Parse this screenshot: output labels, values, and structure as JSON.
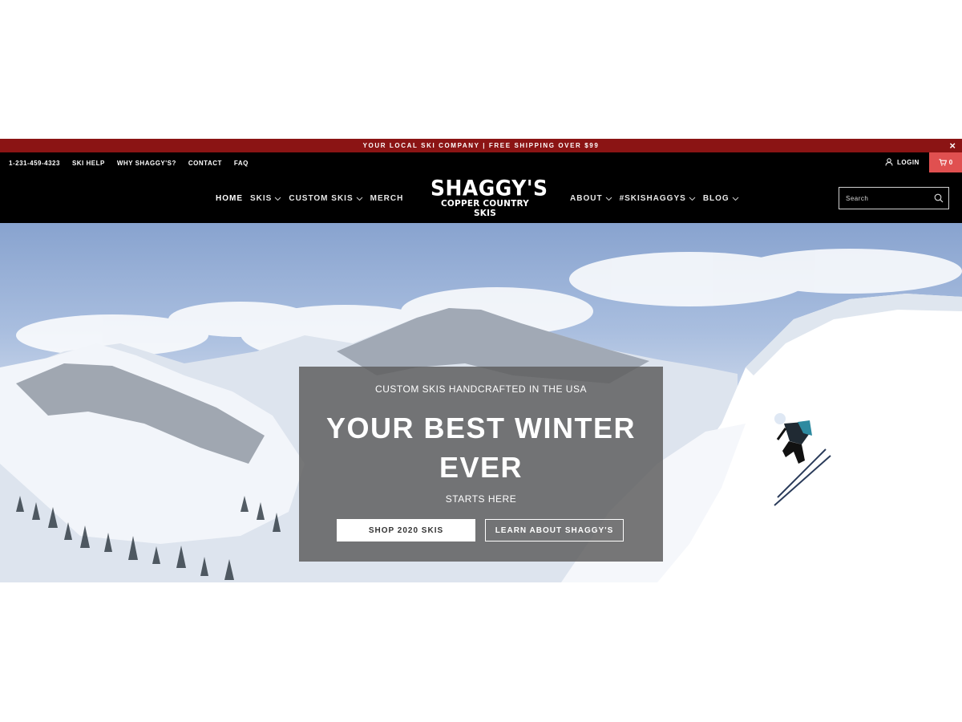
{
  "announcement": {
    "text": "YOUR LOCAL SKI COMPANY | FREE SHIPPING OVER $99",
    "close": "×"
  },
  "utility_nav": {
    "phone": "1-231-459-4323",
    "links": [
      "SKI HELP",
      "WHY SHAGGY'S?",
      "CONTACT",
      "FAQ"
    ]
  },
  "account": {
    "login": "LOGIN",
    "cart_count": "0"
  },
  "main_nav": {
    "left": [
      {
        "label": "HOME"
      },
      {
        "label": "SKIS"
      },
      {
        "label": "CUSTOM SKIS"
      },
      {
        "label": "MERCH"
      }
    ],
    "right": [
      {
        "label": "ABOUT"
      },
      {
        "label": "#SKISHAGGYS"
      },
      {
        "label": "BLOG"
      }
    ]
  },
  "logo": {
    "main": "SHAGGY'S",
    "sub": "COPPER COUNTRY SKIS"
  },
  "search": {
    "placeholder": "Search"
  },
  "hero": {
    "pretitle": "CUSTOM SKIS HANDCRAFTED IN THE USA",
    "title_line1": "YOUR BEST WINTER",
    "title_line2": "EVER",
    "subtitle": "STARTS HERE",
    "primary_button": "SHOP 2020 SKIS",
    "secondary_button": "LEARN ABOUT SHAGGY'S"
  },
  "colors": {
    "announcement_bg": "#8b1414",
    "header_bg": "#000000",
    "cart_bg": "#e05050",
    "overlay_bg": "rgba(95,95,95,0.85)"
  },
  "icons": {
    "login": "user-icon",
    "cart": "cart-icon",
    "search": "search-icon",
    "dropdown": "chevron-down-icon",
    "close": "close-icon"
  }
}
